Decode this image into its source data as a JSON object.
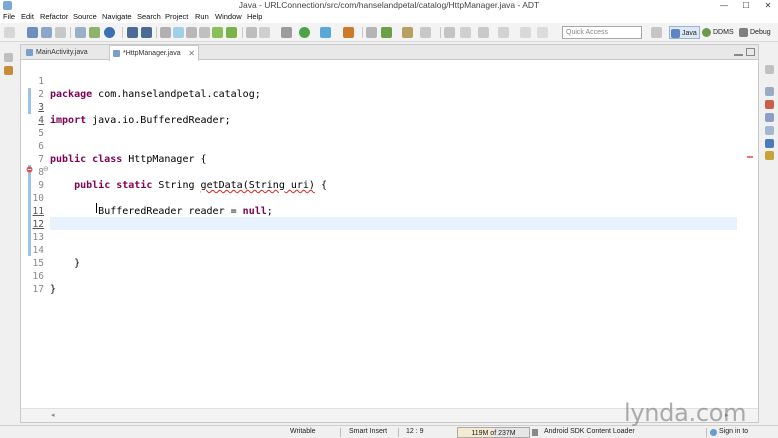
{
  "window": {
    "title": "Java - URLConnection/src/com/hanselandpetal/catalog/HttpManager.java - ADT",
    "minimize": "—",
    "maximize": "☐",
    "close": "✕"
  },
  "menu": [
    "File",
    "Edit",
    "Refactor",
    "Source",
    "Navigate",
    "Search",
    "Project",
    "Run",
    "Window",
    "Help"
  ],
  "toolbar": {
    "quick_access_placeholder": "Quick Access",
    "perspectives": [
      "Java",
      "DDMS",
      "Debug"
    ]
  },
  "editor": {
    "tabs": [
      {
        "label": "MainActivity.java",
        "active": false
      },
      {
        "label": "*HttpManager.java",
        "active": true,
        "close": "✕"
      }
    ],
    "line_numbers": [
      "1",
      "2",
      "3",
      "4",
      "5",
      "6",
      "7",
      "8",
      "9",
      "10",
      "11",
      "12",
      "13",
      "14",
      "15",
      "16",
      "17"
    ],
    "code": {
      "l1_kw": "package",
      "l1_rest": " com.hanselandpetal.catalog;",
      "l3_kw": "import",
      "l3_rest": " java.io.BufferedReader;",
      "l6_kw": "public class",
      "l6_rest": " HttpManager {",
      "l8_indent": "    ",
      "l8_kw": "public static",
      "l8_type": " String ",
      "l8_method": "getData(String uri)",
      "l8_rest": " {",
      "l10_indent": "        ",
      "l10_text": "BufferedReader reader = ",
      "l10_kw": "null",
      "l10_end": ";",
      "l14_text": "    }",
      "l16_text": "}"
    },
    "current_line": 12,
    "cursor": {
      "line": 12,
      "column": 9
    }
  },
  "status": {
    "writable": "Writable",
    "insert_mode": "Smart Insert",
    "position": "12 : 9",
    "heap": "119M of 237M",
    "heap_used_fraction": 0.502,
    "task": "Android SDK Content Loader",
    "sign_in": "Sign in to Google..."
  },
  "watermark": "lynda.com",
  "colors": {
    "keyword": "#7f0055",
    "current_line": "#e8f2fe",
    "change_marker": "#9cc3ea",
    "error_squiggle": "#e02020"
  }
}
